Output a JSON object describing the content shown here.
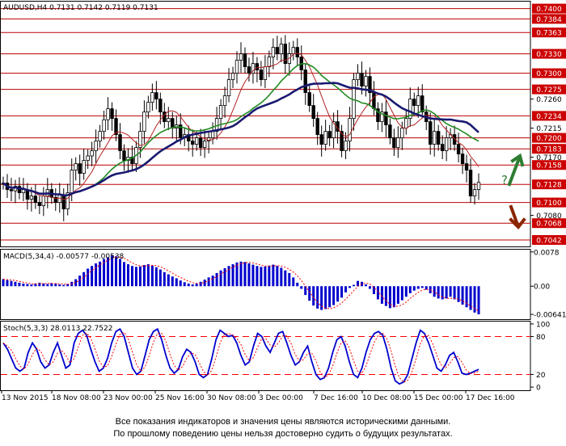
{
  "colors": {
    "resistance": "#b80000",
    "price_badge": "#cc0000",
    "candle": "#000000",
    "ma_fast": "#b22222",
    "ma_mid": "#228b22",
    "ma_slow": "#191970",
    "macd_bar": "#0000cd",
    "signal": "#ff0000",
    "stoch_main": "#0000cd",
    "arrow_up": "#2e7d32",
    "arrow_down": "#8b2500"
  },
  "icons": {
    "up": "trend-up-arrow-icon",
    "down": "trend-down-arrow-icon",
    "question": "question-mark-icon"
  },
  "chart_data": [
    {
      "type": "candlestick",
      "title": "AUDUSD,H4  0.7131 0.7142 0.7119 0.7131",
      "x_tick_labels": [
        "13 Nov 2015",
        "18 Nov 08:00",
        "23 Nov 00:00",
        "25 Nov 16:00",
        "30 Nov 08:00",
        "3 Dec 00:00",
        "7 Dec 16:00",
        "10 Dec 08:00",
        "15 Dec 00:00",
        "17 Dec 16:00"
      ],
      "y_tick_labels": [
        "0.7260",
        "0.7215",
        "0.7170",
        "0.7080"
      ],
      "ylim": [
        0.7032,
        0.7412
      ],
      "resistance_levels": [
        "0.7400",
        "0.7384",
        "0.7363",
        "0.7330",
        "0.7300",
        "0.7275",
        "0.7234",
        "0.7200",
        "0.7183",
        "0.7158",
        "0.7128",
        "0.7100",
        "0.7068",
        "0.7042"
      ],
      "annotation": "?",
      "close_series": [
        0.713,
        0.712,
        0.7118,
        0.7125,
        0.7115,
        0.712,
        0.7105,
        0.711,
        0.71,
        0.7095,
        0.711,
        0.712,
        0.7108,
        0.71,
        0.7112,
        0.709,
        0.7115,
        0.715,
        0.716,
        0.7145,
        0.7165,
        0.7172,
        0.718,
        0.7195,
        0.721,
        0.7228,
        0.7245,
        0.723,
        0.7205,
        0.718,
        0.7165,
        0.717,
        0.716,
        0.7185,
        0.721,
        0.724,
        0.7255,
        0.727,
        0.726,
        0.724,
        0.7225,
        0.723,
        0.7215,
        0.722,
        0.72,
        0.7205,
        0.7195,
        0.719,
        0.72,
        0.7185,
        0.7195,
        0.72,
        0.721,
        0.723,
        0.725,
        0.7265,
        0.729,
        0.73,
        0.732,
        0.733,
        0.731,
        0.73,
        0.7315,
        0.7305,
        0.729,
        0.731,
        0.7325,
        0.734,
        0.733,
        0.7345,
        0.7315,
        0.733,
        0.734,
        0.7325,
        0.7305,
        0.727,
        0.725,
        0.723,
        0.7205,
        0.719,
        0.721,
        0.72,
        0.7225,
        0.721,
        0.718,
        0.7195,
        0.723,
        0.729,
        0.73,
        0.728,
        0.7295,
        0.727,
        0.7245,
        0.7225,
        0.724,
        0.722,
        0.72,
        0.7185,
        0.72,
        0.7215,
        0.723,
        0.726,
        0.725,
        0.7265,
        0.724,
        0.7225,
        0.719,
        0.721,
        0.719,
        0.718,
        0.72,
        0.7205,
        0.719,
        0.7175,
        0.716,
        0.715,
        0.711,
        0.712,
        0.7131
      ]
    },
    {
      "type": "bar",
      "title": "MACD(5,34,4) -0.00577 -0.00538",
      "y_tick_labels": [
        "0.0078",
        "0.00",
        "-0.00641"
      ],
      "ylim": [
        -0.0075,
        0.0085
      ],
      "series": [
        {
          "name": "MACD",
          "values": [
            0.0016,
            0.0014,
            0.0012,
            0.001,
            0.0008,
            0.0006,
            0.0005,
            0.0004,
            0.0006,
            0.0008,
            0.0006,
            0.0005,
            0.0007,
            0.0006,
            0.0004,
            0.0003,
            0.0005,
            0.001,
            0.0016,
            0.0024,
            0.0032,
            0.004,
            0.0046,
            0.0052,
            0.0056,
            0.0062,
            0.0066,
            0.007,
            0.0068,
            0.0062,
            0.0055,
            0.005,
            0.0046,
            0.0044,
            0.0045,
            0.0048,
            0.005,
            0.0047,
            0.0043,
            0.0038,
            0.0032,
            0.0027,
            0.0022,
            0.0018,
            0.0013,
            0.0009,
            0.0006,
            0.0004,
            0.0006,
            0.001,
            0.0015,
            0.002,
            0.0024,
            0.003,
            0.0036,
            0.0041,
            0.0046,
            0.005,
            0.0054,
            0.0056,
            0.0055,
            0.0052,
            0.0049,
            0.0046,
            0.0044,
            0.0045,
            0.0047,
            0.0049,
            0.0046,
            0.0042,
            0.0036,
            0.003,
            0.002,
            0.0008,
            -0.0006,
            -0.002,
            -0.0033,
            -0.0044,
            -0.0051,
            -0.0054,
            -0.0052,
            -0.0048,
            -0.0043,
            -0.0035,
            -0.0026,
            -0.0014,
            -0.0004,
            0.0003,
            0.0012,
            0.001,
            0.0004,
            -0.0006,
            -0.0018,
            -0.003,
            -0.004,
            -0.0045,
            -0.005,
            -0.0048,
            -0.004,
            -0.0032,
            -0.0024,
            -0.0016,
            -0.001,
            -0.0006,
            -0.0004,
            -0.0008,
            -0.0016,
            -0.0024,
            -0.0028,
            -0.003,
            -0.0028,
            -0.0024,
            -0.003,
            -0.0036,
            -0.0042,
            -0.0048,
            -0.0054,
            -0.006,
            -0.0064
          ]
        }
      ]
    },
    {
      "type": "line",
      "title": "Stoch(5,3,3) 28.0113 22.7522",
      "y_tick_labels": [
        "100",
        "80",
        "20",
        "0"
      ],
      "ylim": [
        -5,
        105
      ],
      "series": [
        {
          "name": "%K",
          "values": [
            70,
            60,
            45,
            30,
            25,
            30,
            55,
            70,
            60,
            40,
            30,
            35,
            55,
            70,
            50,
            30,
            35,
            70,
            85,
            90,
            82,
            60,
            40,
            25,
            30,
            45,
            70,
            88,
            92,
            80,
            55,
            30,
            20,
            25,
            50,
            75,
            88,
            92,
            75,
            50,
            30,
            22,
            28,
            48,
            60,
            55,
            40,
            20,
            15,
            20,
            45,
            75,
            90,
            85,
            80,
            82,
            70,
            50,
            35,
            40,
            65,
            85,
            80,
            65,
            55,
            70,
            85,
            88,
            70,
            50,
            35,
            40,
            55,
            65,
            40,
            20,
            12,
            15,
            30,
            55,
            75,
            80,
            65,
            40,
            20,
            15,
            30,
            55,
            75,
            85,
            88,
            82,
            60,
            30,
            10,
            5,
            8,
            20,
            45,
            70,
            90,
            85,
            70,
            50,
            30,
            25,
            35,
            50,
            55,
            40,
            22,
            20,
            22,
            25,
            28
          ]
        }
      ]
    }
  ],
  "disclaimer": {
    "line1": "Все показания индикаторов и значения цены являются историческими данными.",
    "line2": "По прошлому поведению цены нельзя достоверно судить о будущих результатах."
  }
}
